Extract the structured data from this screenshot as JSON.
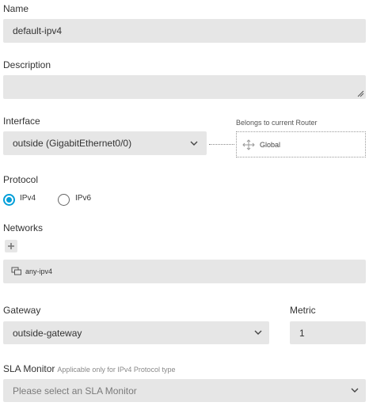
{
  "name": {
    "label": "Name",
    "value": "default-ipv4"
  },
  "description": {
    "label": "Description",
    "value": ""
  },
  "interface": {
    "label": "Interface",
    "value": "outside (GigabitEthernet0/0)",
    "belongs_label": "Belongs to current Router",
    "router_value": "Global",
    "router_icon": "move-arrows-icon"
  },
  "protocol": {
    "label": "Protocol",
    "options": [
      {
        "label": "IPv4",
        "checked": true
      },
      {
        "label": "IPv6",
        "checked": false
      }
    ]
  },
  "networks": {
    "label": "Networks",
    "add_icon": "plus-icon",
    "items": [
      {
        "label": "any-ipv4",
        "icon": "network-object-icon"
      }
    ]
  },
  "gateway": {
    "label": "Gateway",
    "value": "outside-gateway"
  },
  "metric": {
    "label": "Metric",
    "value": "1"
  },
  "sla": {
    "label": "SLA Monitor",
    "hint": "Applicable only for IPv4 Protocol type",
    "placeholder": "Please select an SLA Monitor"
  },
  "colors": {
    "accent": "#049fd9",
    "field_bg": "#e6e6e6"
  }
}
